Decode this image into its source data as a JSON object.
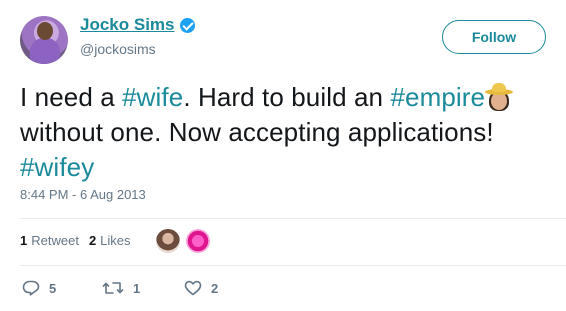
{
  "author": {
    "display_name": "Jocko Sims",
    "handle": "@jockosims",
    "verified": true
  },
  "follow_button": {
    "label": "Follow"
  },
  "tweet": {
    "segments": [
      {
        "text": "I need a ",
        "type": "text"
      },
      {
        "text": "#wife",
        "type": "hashtag"
      },
      {
        "text": ". Hard to build an ",
        "type": "text"
      },
      {
        "text": "#empire",
        "type": "hashtag"
      },
      {
        "emoji": "cowgirl-hat-woman"
      },
      {
        "text": " without one. Now accepting applications! ",
        "type": "text"
      },
      {
        "text": "#wifey",
        "type": "hashtag"
      }
    ],
    "timestamp": "8:44 PM - 6 Aug 2013"
  },
  "stats": {
    "retweets_count": "1",
    "retweets_label": "Retweet",
    "likes_count": "2",
    "likes_label": "Likes"
  },
  "actions": {
    "reply_count": "5",
    "retweet_count": "1",
    "like_count": "2"
  },
  "colors": {
    "accent": "#1b8a9a",
    "muted": "#657786",
    "text": "#14171a",
    "divider": "#e6ecf0"
  }
}
